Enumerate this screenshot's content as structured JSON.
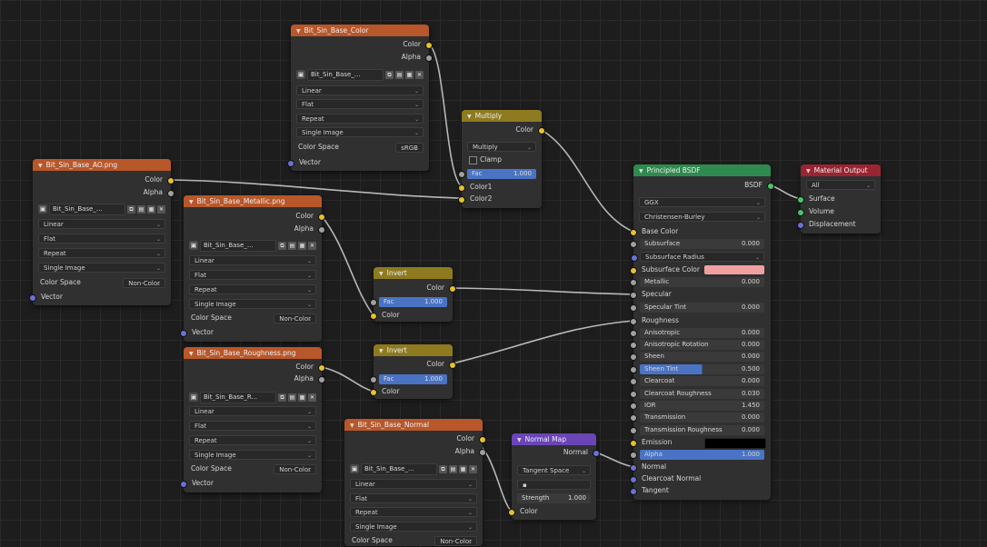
{
  "colors": {
    "texture_header": "#b8572a",
    "mix_header": "#8e7a1f",
    "bsdf_header": "#2f8a4f",
    "output_header": "#9a2431",
    "vector_header": "#6a45b8",
    "subsurface_color": "#f0a0a0",
    "emission_color": "#000000",
    "alpha_bar": "#4a73c4"
  },
  "nodes": {
    "tex_basecolor": {
      "title": "Bit_Sin_Base_Color",
      "out_color": "Color",
      "out_alpha": "Alpha",
      "image_name": "Bit_Sin_Base_...",
      "interp": "Linear",
      "proj": "Flat",
      "ext": "Repeat",
      "source": "Single Image",
      "cs_label": "Color Space",
      "cs_value": "sRGB",
      "in_vector": "Vector"
    },
    "tex_ao": {
      "title": "Bit_Sin_Base_AO.png",
      "out_color": "Color",
      "out_alpha": "Alpha",
      "image_name": "Bit_Sin_Base_...",
      "interp": "Linear",
      "proj": "Flat",
      "ext": "Repeat",
      "source": "Single Image",
      "cs_label": "Color Space",
      "cs_value": "Non-Color",
      "in_vector": "Vector"
    },
    "tex_metallic": {
      "title": "Bit_Sin_Base_Metallic.png",
      "out_color": "Color",
      "out_alpha": "Alpha",
      "image_name": "Bit_Sin_Base_...",
      "interp": "Linear",
      "proj": "Flat",
      "ext": "Repeat",
      "source": "Single Image",
      "cs_label": "Color Space",
      "cs_value": "Non-Color",
      "in_vector": "Vector"
    },
    "tex_roughness": {
      "title": "Bit_Sin_Base_Roughness.png",
      "out_color": "Color",
      "out_alpha": "Alpha",
      "image_name": "Bit_Sin_Base_R...",
      "interp": "Linear",
      "proj": "Flat",
      "ext": "Repeat",
      "source": "Single Image",
      "cs_label": "Color Space",
      "cs_value": "Non-Color",
      "in_vector": "Vector"
    },
    "tex_normal": {
      "title": "Bit_Sin_Base_Normal",
      "out_color": "Color",
      "out_alpha": "Alpha",
      "image_name": "Bit_Sin_Base_...",
      "interp": "Linear",
      "proj": "Flat",
      "ext": "Repeat",
      "source": "Single Image",
      "cs_label": "Color Space",
      "cs_value": "Non-Color"
    },
    "mix_multiply": {
      "title": "Multiply",
      "out_color": "Color",
      "blend": "Multiply",
      "clamp": "Clamp",
      "fac_label": "Fac",
      "fac_value": "1.000",
      "in_color1": "Color1",
      "in_color2": "Color2"
    },
    "invert1": {
      "title": "Invert",
      "out_color": "Color",
      "fac_label": "Fac",
      "fac_value": "1.000",
      "in_color": "Color"
    },
    "invert2": {
      "title": "Invert",
      "out_color": "Color",
      "fac_label": "Fac",
      "fac_value": "1.000",
      "in_color": "Color"
    },
    "normal_map": {
      "title": "Normal Map",
      "out_normal": "Normal",
      "space": "Tangent Space",
      "uv": "",
      "strength_label": "Strength",
      "strength_value": "1.000",
      "in_color": "Color"
    },
    "bsdf": {
      "title": "Principled BSDF",
      "out_bsdf": "BSDF",
      "distribution": "GGX",
      "subsurface_method": "Christensen-Burley",
      "base_color": "Base Color",
      "subsurface": "Subsurface",
      "subsurface_val": "0.000",
      "subsurface_radius": "Subsurface Radius",
      "subsurface_color": "Subsurface Color",
      "metallic": "Metallic",
      "metallic_val": "0.000",
      "specular": "Specular",
      "specular_tint": "Specular Tint",
      "specular_tint_val": "0.000",
      "roughness": "Roughness",
      "anisotropic": "Anisotropic",
      "anisotropic_val": "0.000",
      "anisotropic_rotation": "Anisotropic Rotation",
      "anisotropic_rotation_val": "0.000",
      "sheen": "Sheen",
      "sheen_val": "0.000",
      "sheen_tint": "Sheen Tint",
      "sheen_tint_val": "0.500",
      "clearcoat": "Clearcoat",
      "clearcoat_val": "0.000",
      "clearcoat_roughness": "Clearcoat Roughness",
      "clearcoat_roughness_val": "0.030",
      "ior": "IOR",
      "ior_val": "1.450",
      "transmission": "Transmission",
      "transmission_val": "0.000",
      "transmission_roughness": "Transmission Roughness",
      "transmission_roughness_val": "0.000",
      "emission": "Emission",
      "alpha": "Alpha",
      "alpha_val": "1.000",
      "normal": "Normal",
      "clearcoat_normal": "Clearcoat Normal",
      "tangent": "Tangent"
    },
    "material_output": {
      "title": "Material Output",
      "target": "All",
      "surface": "Surface",
      "volume": "Volume",
      "displacement": "Displacement"
    }
  }
}
